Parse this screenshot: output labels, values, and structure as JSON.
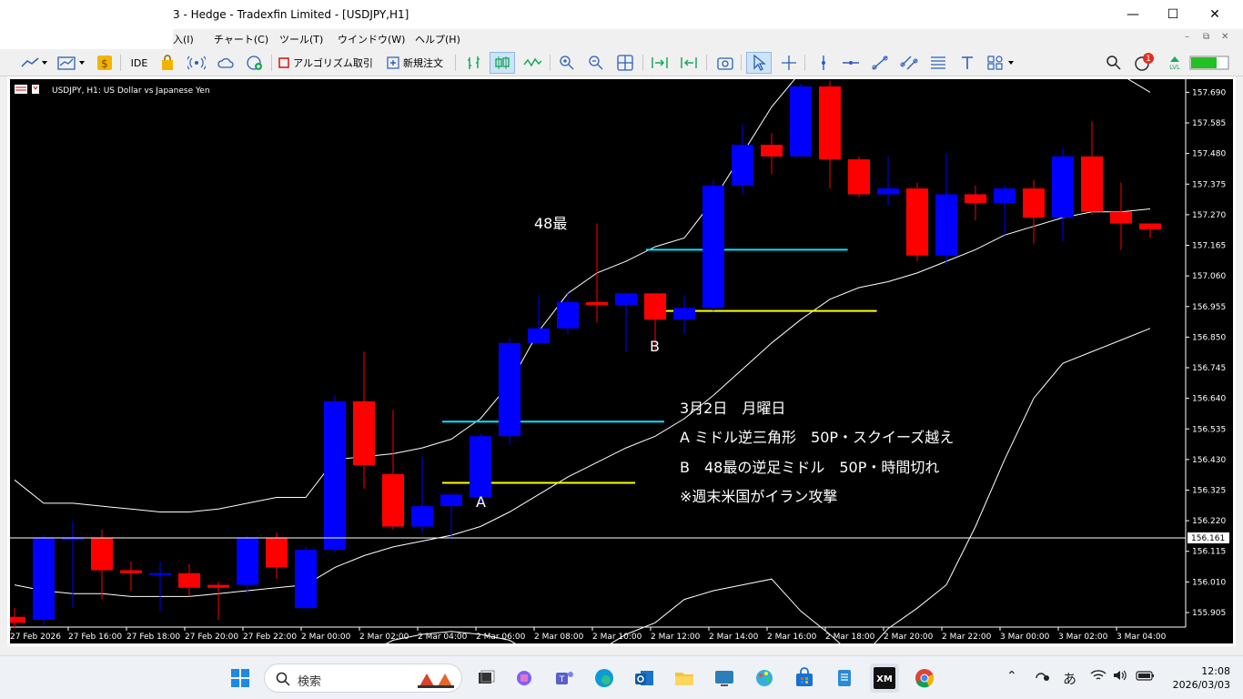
{
  "window": {
    "title": "3 - Hedge - Tradexfin Limited - [USDJPY,H1]",
    "minimize": "—",
    "maximize": "☐",
    "close": "✕"
  },
  "menu": {
    "items": [
      "入(I)",
      "チャート(C)",
      "ツール(T)",
      "ウインドウ(W)",
      "ヘルプ(H)"
    ],
    "mdi": [
      "–",
      "⧉",
      "✕"
    ]
  },
  "toolbar": {
    "ide_label": "IDE",
    "algo_label": "アルゴリズム取引",
    "new_order_label": "新規注文",
    "notification_count": "1",
    "level_label": "LVL"
  },
  "chart": {
    "header": "USDJPY, H1:  US Dollar vs Japanese Yen",
    "current_price_label": "156.161",
    "annotations": {
      "label_48": "48最",
      "label_a": "A",
      "label_b": "B",
      "note_date": "3月2日　月曜日",
      "note_a": "A  ミドル逆三角形　50P・スクイーズ越え",
      "note_b": "B　48最の逆足ミドル　50P・時間切れ",
      "note_event": "※週末米国がイラン攻撃"
    },
    "colors": {
      "bull": "#0000ff",
      "bear": "#ff0000",
      "bands": "#ffffff",
      "cyan_line": "#00e5ff",
      "yellow_line": "#ffff00",
      "background": "#000000"
    }
  },
  "chart_data": {
    "type": "candlestick",
    "symbol": "USDJPY",
    "timeframe": "H1",
    "y_ticks": [
      "157.690",
      "157.585",
      "157.480",
      "157.375",
      "157.270",
      "157.165",
      "157.060",
      "156.955",
      "156.850",
      "156.745",
      "156.640",
      "156.535",
      "156.430",
      "156.325",
      "156.220",
      "156.115",
      "156.010",
      "155.905"
    ],
    "x_ticks": [
      "27 Feb 2026",
      "27 Feb 16:00",
      "27 Feb 18:00",
      "27 Feb 20:00",
      "27 Feb 22:00",
      "2 Mar 00:00",
      "2 Mar 02:00",
      "2 Mar 04:00",
      "2 Mar 06:00",
      "2 Mar 08:00",
      "2 Mar 10:00",
      "2 Mar 12:00",
      "2 Mar 14:00",
      "2 Mar 16:00",
      "2 Mar 18:00",
      "2 Mar 20:00",
      "2 Mar 22:00",
      "3 Mar 00:00",
      "3 Mar 02:00",
      "3 Mar 04:00"
    ],
    "ylim": [
      155.855,
      157.735
    ],
    "candles": [
      {
        "o": 155.89,
        "h": 155.92,
        "c": 155.87,
        "l": 155.85
      },
      {
        "o": 155.88,
        "h": 156.17,
        "c": 156.16,
        "l": 155.86
      },
      {
        "o": 156.16,
        "h": 156.22,
        "c": 156.16,
        "l": 155.92
      },
      {
        "o": 156.16,
        "h": 156.19,
        "c": 156.05,
        "l": 155.95
      },
      {
        "o": 156.05,
        "h": 156.08,
        "c": 156.04,
        "l": 155.98
      },
      {
        "o": 156.04,
        "h": 156.08,
        "c": 156.04,
        "l": 155.91
      },
      {
        "o": 156.04,
        "h": 156.07,
        "c": 155.99,
        "l": 155.96
      },
      {
        "o": 156.0,
        "h": 156.01,
        "c": 155.99,
        "l": 155.88
      },
      {
        "o": 156.0,
        "h": 156.17,
        "c": 156.16,
        "l": 155.97
      },
      {
        "o": 156.16,
        "h": 156.18,
        "c": 156.06,
        "l": 156.02
      },
      {
        "o": 155.92,
        "h": 156.13,
        "c": 156.12,
        "l": 155.92
      },
      {
        "o": 156.12,
        "h": 156.65,
        "c": 156.63,
        "l": 156.11
      },
      {
        "o": 156.63,
        "h": 156.8,
        "c": 156.41,
        "l": 156.33
      },
      {
        "o": 156.38,
        "h": 156.6,
        "c": 156.2,
        "l": 156.19
      },
      {
        "o": 156.2,
        "h": 156.44,
        "c": 156.27,
        "l": 156.18
      },
      {
        "o": 156.27,
        "h": 156.3,
        "c": 156.31,
        "l": 156.16
      },
      {
        "o": 156.3,
        "h": 156.52,
        "c": 156.51,
        "l": 156.28
      },
      {
        "o": 156.51,
        "h": 156.85,
        "c": 156.83,
        "l": 156.48
      },
      {
        "o": 156.83,
        "h": 156.99,
        "c": 156.88,
        "l": 156.86
      },
      {
        "o": 156.88,
        "h": 157.0,
        "c": 156.97,
        "l": 156.86
      },
      {
        "o": 156.97,
        "h": 157.24,
        "c": 156.96,
        "l": 156.9
      },
      {
        "o": 156.96,
        "h": 157.0,
        "c": 157.0,
        "l": 156.8
      },
      {
        "o": 157.0,
        "h": 157.0,
        "c": 156.91,
        "l": 156.8
      },
      {
        "o": 156.91,
        "h": 156.99,
        "c": 156.95,
        "l": 156.86
      },
      {
        "o": 156.95,
        "h": 157.39,
        "c": 157.37,
        "l": 156.94
      },
      {
        "o": 157.37,
        "h": 157.58,
        "c": 157.51,
        "l": 157.34
      },
      {
        "o": 157.51,
        "h": 157.55,
        "c": 157.47,
        "l": 157.41
      },
      {
        "o": 157.47,
        "h": 157.72,
        "c": 157.71,
        "l": 157.47
      },
      {
        "o": 157.71,
        "h": 157.73,
        "c": 157.46,
        "l": 157.36
      },
      {
        "o": 157.46,
        "h": 157.47,
        "c": 157.34,
        "l": 157.33
      },
      {
        "o": 157.34,
        "h": 157.47,
        "c": 157.36,
        "l": 157.3
      },
      {
        "o": 157.36,
        "h": 157.38,
        "c": 157.13,
        "l": 157.11
      },
      {
        "o": 157.13,
        "h": 157.48,
        "c": 157.34,
        "l": 157.1
      },
      {
        "o": 157.34,
        "h": 157.37,
        "c": 157.31,
        "l": 157.25
      },
      {
        "o": 157.31,
        "h": 157.37,
        "c": 157.36,
        "l": 157.2
      },
      {
        "o": 157.36,
        "h": 157.39,
        "c": 157.26,
        "l": 157.17
      },
      {
        "o": 157.26,
        "h": 157.5,
        "c": 157.47,
        "l": 157.18
      },
      {
        "o": 157.47,
        "h": 157.59,
        "c": 157.28,
        "l": 157.27
      },
      {
        "o": 157.28,
        "h": 157.38,
        "c": 157.24,
        "l": 157.15
      },
      {
        "o": 157.24,
        "h": 157.24,
        "c": 157.22,
        "l": 157.19
      }
    ],
    "bands": {
      "upper": [
        156.36,
        156.28,
        156.28,
        156.27,
        156.26,
        156.25,
        156.25,
        156.26,
        156.28,
        156.3,
        156.3,
        156.43,
        156.44,
        156.45,
        156.47,
        156.5,
        156.57,
        156.69,
        156.87,
        157.0,
        157.07,
        157.11,
        157.16,
        157.19,
        157.32,
        157.48,
        157.64,
        157.76,
        157.8,
        157.83,
        157.84,
        157.84,
        157.84,
        157.83,
        157.81,
        157.79,
        157.77,
        157.76,
        157.75,
        157.69
      ],
      "middle": [
        156.0,
        155.98,
        155.97,
        155.97,
        155.96,
        155.96,
        155.96,
        155.97,
        155.98,
        155.99,
        156.0,
        156.06,
        156.1,
        156.13,
        156.15,
        156.17,
        156.2,
        156.25,
        156.31,
        156.37,
        156.42,
        156.47,
        156.51,
        156.57,
        156.65,
        156.74,
        156.83,
        156.91,
        156.98,
        157.02,
        157.04,
        157.07,
        157.11,
        157.15,
        157.2,
        157.23,
        157.26,
        157.28,
        157.28,
        157.29
      ],
      "lower": [
        155.64,
        155.68,
        155.67,
        155.66,
        155.66,
        155.66,
        155.66,
        155.67,
        155.68,
        155.69,
        155.7,
        155.69,
        155.76,
        155.81,
        155.83,
        155.84,
        155.83,
        155.81,
        155.75,
        155.74,
        155.77,
        155.83,
        155.87,
        155.95,
        155.98,
        156.0,
        156.02,
        155.91,
        155.83,
        155.74,
        155.85,
        155.92,
        156.0,
        156.2,
        156.43,
        156.64,
        156.76,
        156.8,
        156.84,
        156.88
      ]
    },
    "horizontal_lines": [
      {
        "price": 157.15,
        "from_index": 22,
        "to_index": 28.3,
        "color": "cyan"
      },
      {
        "price": 156.94,
        "from_index": 22,
        "to_index": 29.3,
        "color": "yellow"
      },
      {
        "price": 156.56,
        "from_index": 15,
        "to_index": 22,
        "color": "cyan"
      },
      {
        "price": 156.35,
        "from_index": 15,
        "to_index": 21,
        "color": "yellow"
      }
    ],
    "current_price": 156.161
  },
  "taskbar": {
    "search_placeholder": "検索",
    "ime": "あ",
    "time": "12:08",
    "date": "2026/03/03"
  }
}
